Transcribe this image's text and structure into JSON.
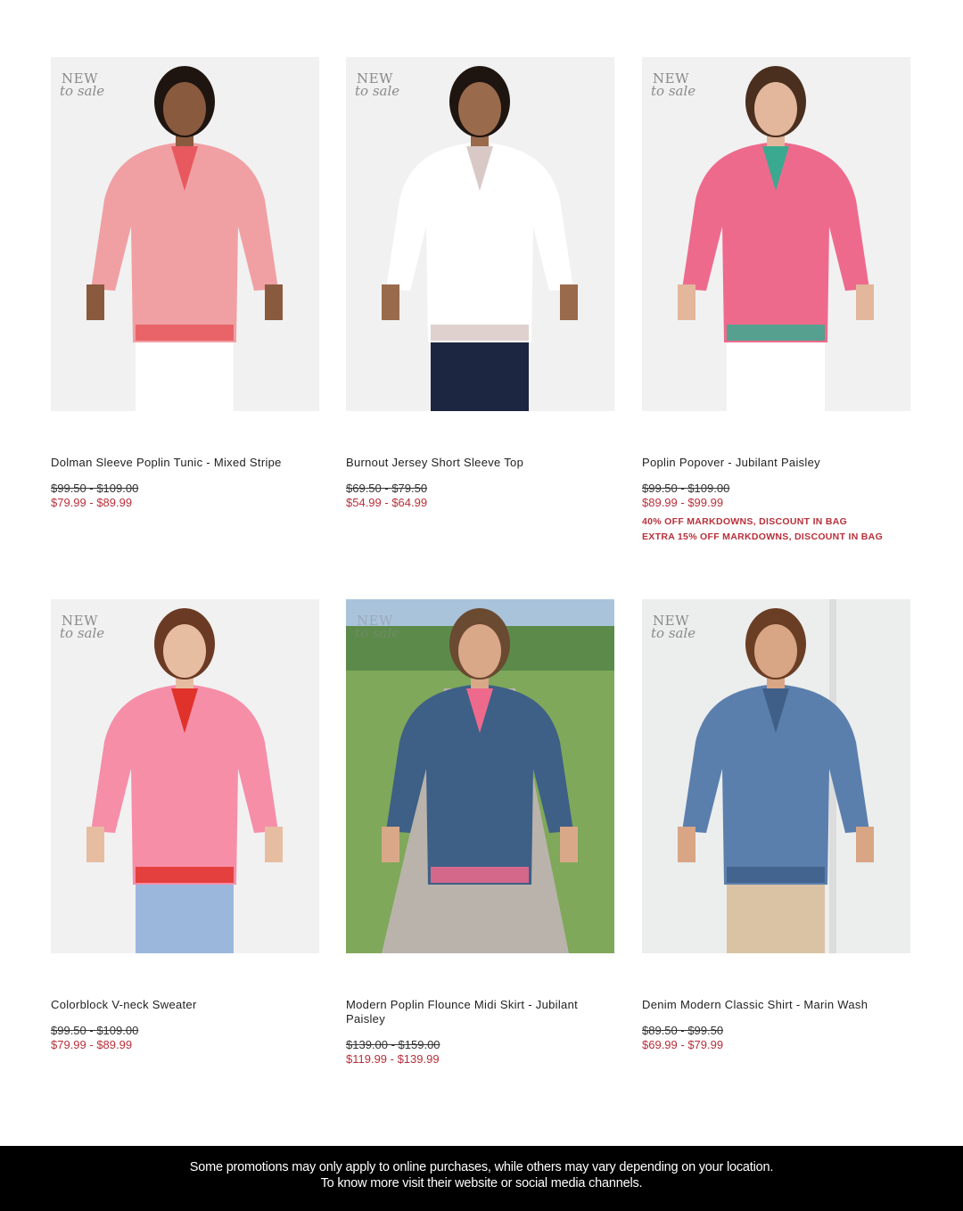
{
  "badge": {
    "line1": "NEW",
    "line2": "to sale"
  },
  "products": [
    {
      "name": "Dolman Sleeve Poplin Tunic - Mixed Stripe",
      "original_price": "$99.50 - $109.00",
      "sale_price": "$79.99 - $89.99",
      "promos": [],
      "colors": {
        "bg": "#f1f1f1",
        "top": "#f0a0a3",
        "accent": "#e8595f",
        "bottom": "#ffffff",
        "skin": "#8a5a3f",
        "hair": "#1f1510"
      }
    },
    {
      "name": "Burnout Jersey Short Sleeve Top",
      "original_price": "$69.50 - $79.50",
      "sale_price": "$54.99 - $64.99",
      "promos": [],
      "colors": {
        "bg": "#f1f1f1",
        "top": "#ffffff",
        "accent": "#d9c9c6",
        "bottom": "#1d2640",
        "skin": "#9a6a4c",
        "hair": "#1f1510"
      }
    },
    {
      "name": "Poplin Popover - Jubilant Paisley",
      "original_price": "$99.50 - $109.00",
      "sale_price": "$89.99 - $99.99",
      "promos": [
        "40% OFF MARKDOWNS, DISCOUNT IN BAG",
        "EXTRA 15% OFF MARKDOWNS, DISCOUNT IN BAG"
      ],
      "colors": {
        "bg": "#f1f1f1",
        "top": "#ee6a8c",
        "accent": "#3aa98f",
        "bottom": "#ffffff",
        "skin": "#e3b79c",
        "hair": "#4a2e1e"
      }
    },
    {
      "name": "Colorblock V-neck Sweater",
      "original_price": "$99.50 - $109.00",
      "sale_price": "$79.99 - $89.99",
      "promos": [],
      "colors": {
        "bg": "#f1f1f1",
        "top": "#f68ea8",
        "accent": "#e0322b",
        "bottom": "#9bb8dc",
        "skin": "#e7bda2",
        "hair": "#6b3a24"
      }
    },
    {
      "name": "Modern Poplin Flounce Midi Skirt - Jubilant Paisley",
      "original_price": "$139.00 - $159.00",
      "sale_price": "$119.99 - $139.99",
      "promos": [],
      "colors": {
        "bg": "#8aa7c2",
        "top": "#3e5f86",
        "accent": "#ee6a8c",
        "bottom": "#b9b3ab",
        "skin": "#d9a888",
        "hair": "#6a4a30"
      }
    },
    {
      "name": "Denim Modern Classic Shirt - Marin Wash",
      "original_price": "$89.50 - $99.50",
      "sale_price": "$69.99 - $79.99",
      "promos": [],
      "colors": {
        "bg": "#eceded",
        "top": "#5b7fad",
        "accent": "#3f5f88",
        "bottom": "#d9c3a4",
        "skin": "#d8a585",
        "hair": "#6a3e24"
      }
    }
  ],
  "footer": {
    "line1": "Some promotions may only apply to online purchases, while others may vary depending on your location.",
    "line2": "To know more visit their website or social media channels."
  }
}
